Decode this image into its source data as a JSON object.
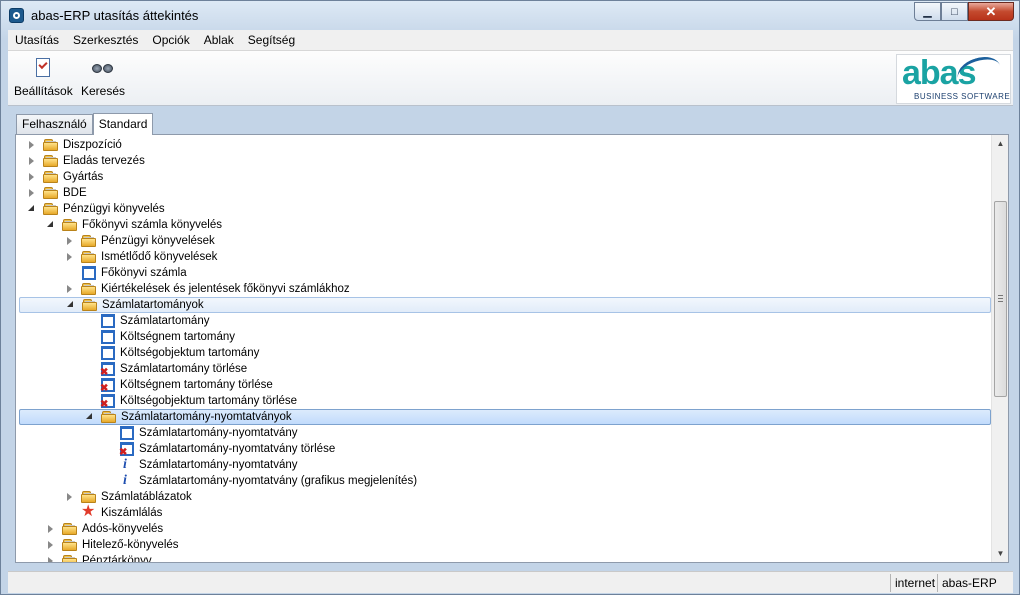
{
  "window": {
    "title": "abas-ERP utasítás áttekintés"
  },
  "menu": [
    "Utasítás",
    "Szerkesztés",
    "Opciók",
    "Ablak",
    "Segítség"
  ],
  "toolbar": {
    "settings_label": "Beállítások",
    "search_label": "Keresés",
    "logo_text": "abas",
    "logo_sub": "BUSINESS SOFTWARE"
  },
  "tabs": [
    {
      "label": "Felhasználó",
      "active": false
    },
    {
      "label": "Standard",
      "active": true
    }
  ],
  "tree": [
    {
      "label": "Diszpozíció",
      "level": 0,
      "toggle": "closed",
      "icon": "folder"
    },
    {
      "label": "Eladás tervezés",
      "level": 0,
      "toggle": "closed",
      "icon": "folder"
    },
    {
      "label": "Gyártás",
      "level": 0,
      "toggle": "closed",
      "icon": "folder"
    },
    {
      "label": "BDE",
      "level": 0,
      "toggle": "closed",
      "icon": "folder"
    },
    {
      "label": "Pénzügyi könyvelés",
      "level": 0,
      "toggle": "open",
      "icon": "folder"
    },
    {
      "label": "Főkönyvi számla könyvelés",
      "level": 1,
      "toggle": "open",
      "icon": "folder"
    },
    {
      "label": "Pénzügyi könyvelések",
      "level": 2,
      "toggle": "closed",
      "icon": "folder"
    },
    {
      "label": "Ismétlődő könyvelések",
      "level": 2,
      "toggle": "closed",
      "icon": "folder"
    },
    {
      "label": "Főkönyvi számla",
      "level": 2,
      "toggle": "none",
      "icon": "doc"
    },
    {
      "label": "Kiértékelések és jelentések főkönyvi számlákhoz",
      "level": 2,
      "toggle": "closed",
      "icon": "folder"
    },
    {
      "label": "Számlatartományok",
      "level": 2,
      "toggle": "open",
      "icon": "folder",
      "state": "hover"
    },
    {
      "label": "Számlatartomány",
      "level": 3,
      "toggle": "none",
      "icon": "doc"
    },
    {
      "label": "Költségnem tartomány",
      "level": 3,
      "toggle": "none",
      "icon": "doc"
    },
    {
      "label": "Költségobjektum tartomány",
      "level": 3,
      "toggle": "none",
      "icon": "doc"
    },
    {
      "label": "Számlatartomány törlése",
      "level": 3,
      "toggle": "none",
      "icon": "del"
    },
    {
      "label": "Költségnem tartomány törlése",
      "level": 3,
      "toggle": "none",
      "icon": "del"
    },
    {
      "label": "Költségobjektum tartomány törlése",
      "level": 3,
      "toggle": "none",
      "icon": "del"
    },
    {
      "label": "Számlatartomány-nyomtatványok",
      "level": 3,
      "toggle": "open",
      "icon": "folder",
      "state": "selected"
    },
    {
      "label": "Számlatartomány-nyomtatvány",
      "level": 4,
      "toggle": "none",
      "icon": "doc"
    },
    {
      "label": "Számlatartomány-nyomtatvány törlése",
      "level": 4,
      "toggle": "none",
      "icon": "del"
    },
    {
      "label": "Számlatartomány-nyomtatvány",
      "level": 4,
      "toggle": "none",
      "icon": "info"
    },
    {
      "label": "Számlatartomány-nyomtatvány (grafikus megjelenítés)",
      "level": 4,
      "toggle": "none",
      "icon": "info"
    },
    {
      "label": "Számlatáblázatok",
      "level": 2,
      "toggle": "closed",
      "icon": "folder"
    },
    {
      "label": "Kiszámlálás",
      "level": 2,
      "toggle": "none",
      "icon": "star"
    },
    {
      "label": "Adós-könyvelés",
      "level": 1,
      "toggle": "closed",
      "icon": "folder"
    },
    {
      "label": "Hitelező-könyvelés",
      "level": 1,
      "toggle": "closed",
      "icon": "folder"
    },
    {
      "label": "Pénztárkönyv",
      "level": 1,
      "toggle": "closed",
      "icon": "folder"
    }
  ],
  "status": {
    "zone": "internet",
    "app": "abas-ERP"
  }
}
